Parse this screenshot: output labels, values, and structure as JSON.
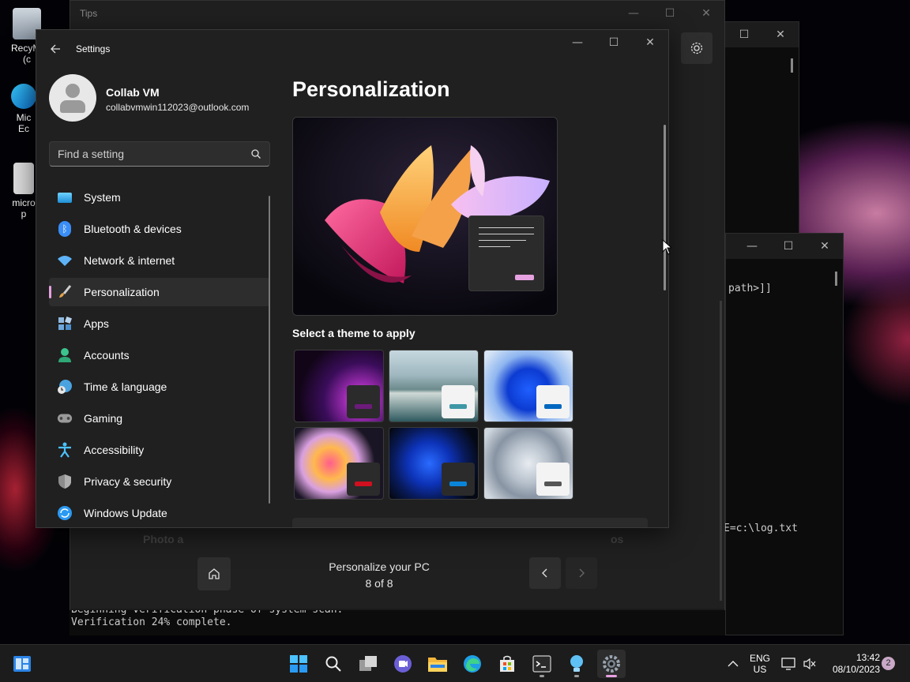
{
  "desktop": {
    "icons": [
      {
        "label": "RecyMi",
        "sub": "(c"
      },
      {
        "label": "Mic",
        "sub": "Ec"
      },
      {
        "label": "micro",
        "sub": "p"
      }
    ],
    "mouse_cursor": "arrow-pointer"
  },
  "terminal_back": {
    "lines": [
      "path>]]",
      "E=c:\\log.txt"
    ]
  },
  "terminal_front": {
    "lines": [
      "Beginning verification phase of system scan.",
      "Verification 24% complete."
    ]
  },
  "tips": {
    "title": "Tips",
    "hidden_left_text": "Photo a",
    "hidden_right_text": "os",
    "caption_title": "Personalize your PC",
    "caption_page": "8 of 8"
  },
  "settings": {
    "title": "Settings",
    "user": {
      "name": "Collab VM",
      "email": "collabvmwin112023@outlook.com"
    },
    "search": {
      "placeholder": "Find a setting",
      "value": ""
    },
    "nav": [
      {
        "label": "System",
        "icon": "monitor-icon",
        "color": "#4cc2ff"
      },
      {
        "label": "Bluetooth & devices",
        "icon": "bluetooth-icon",
        "color": "#3a8ef6"
      },
      {
        "label": "Network & internet",
        "icon": "wifi-icon",
        "color": "#5eb3f8"
      },
      {
        "label": "Personalization",
        "icon": "paintbrush-icon",
        "color": "#e3a24b",
        "selected": true
      },
      {
        "label": "Apps",
        "icon": "apps-icon",
        "color": "#6fa8dc"
      },
      {
        "label": "Accounts",
        "icon": "person-icon",
        "color": "#3cc48e"
      },
      {
        "label": "Time & language",
        "icon": "clock-globe-icon",
        "color": "#4aa3df"
      },
      {
        "label": "Gaming",
        "icon": "gamepad-icon",
        "color": "#9a9a9a"
      },
      {
        "label": "Accessibility",
        "icon": "accessibility-icon",
        "color": "#4cc2ff"
      },
      {
        "label": "Privacy & security",
        "icon": "shield-icon",
        "color": "#8c8c8c"
      },
      {
        "label": "Windows Update",
        "icon": "update-icon",
        "color": "#2b9af3"
      }
    ],
    "page_title": "Personalization",
    "theme_heading": "Select a theme to apply",
    "accent_color": "#e6a1e0",
    "themes": [
      {
        "name": "theme-glow",
        "accent": "#6c1b7a"
      },
      {
        "name": "theme-captured-motion",
        "accent": "#3f97a6"
      },
      {
        "name": "theme-windows-light",
        "accent": "#0067c0"
      },
      {
        "name": "theme-flow",
        "accent": "#d00f1f"
      },
      {
        "name": "theme-windows-dark",
        "accent": "#0a84d8"
      },
      {
        "name": "theme-sunrise",
        "accent": "#555555"
      }
    ]
  },
  "taskbar": {
    "apps": [
      "start-icon",
      "search-icon",
      "task-view-icon",
      "chat-icon",
      "file-explorer-icon",
      "edge-icon",
      "store-icon",
      "terminal-icon",
      "tips-icon",
      "settings-icon"
    ],
    "tray": {
      "lang1": "ENG",
      "lang2": "US",
      "time": "13:42",
      "date": "08/10/2023",
      "notifications": "2"
    }
  }
}
